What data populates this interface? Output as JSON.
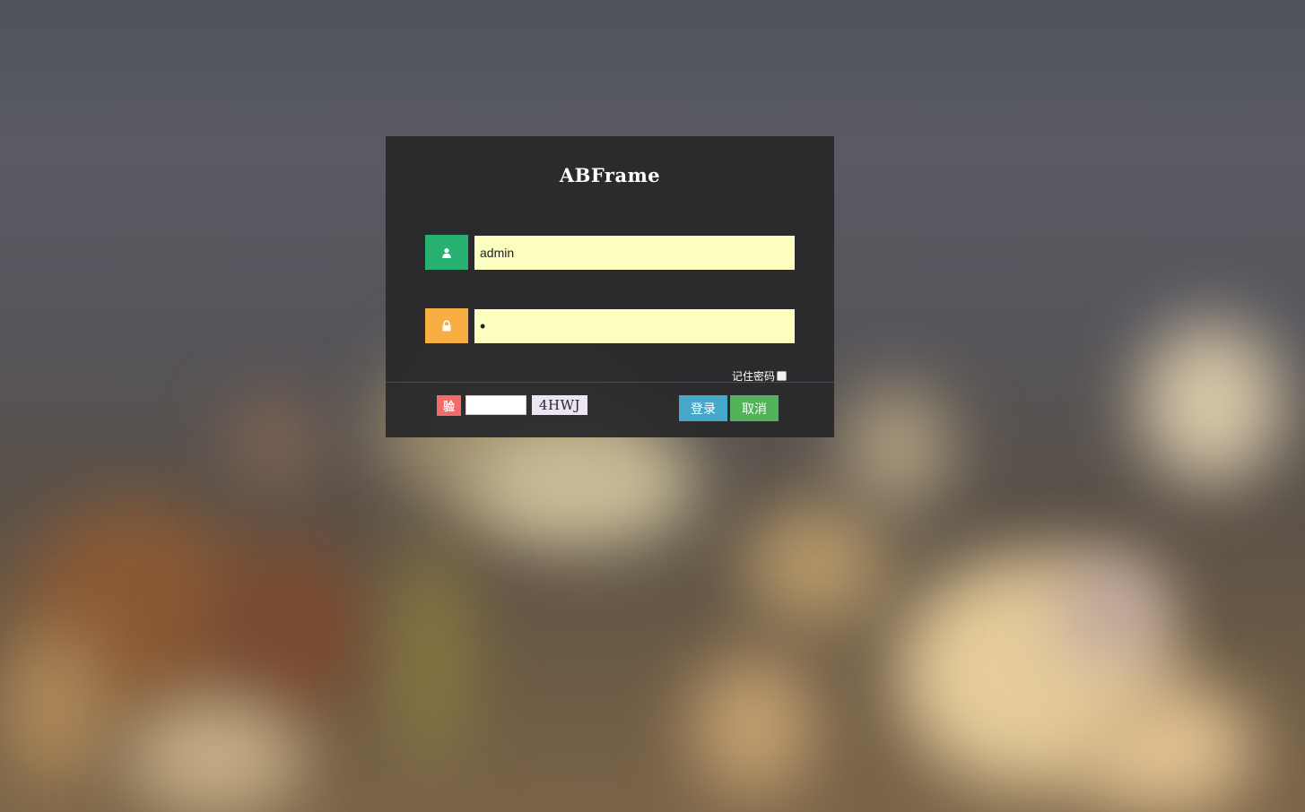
{
  "app": {
    "title": "ABFrame"
  },
  "login": {
    "username_icon": "user-icon",
    "username_value": "admin",
    "password_icon": "lock-icon",
    "password_mask": "•",
    "remember_label": "记住密码",
    "remember_checked": false,
    "verify_label": "验",
    "verify_value": "",
    "captcha_text": "4HWJ",
    "login_label": "登录",
    "cancel_label": "取消"
  },
  "colors": {
    "user_icon_bg": "#27b06f",
    "lock_icon_bg": "#f8ae43",
    "field_bg": "#fbfebe",
    "verify_bg": "#f26c6c",
    "login_bg": "#45a8c8",
    "cancel_bg": "#52b25a"
  }
}
